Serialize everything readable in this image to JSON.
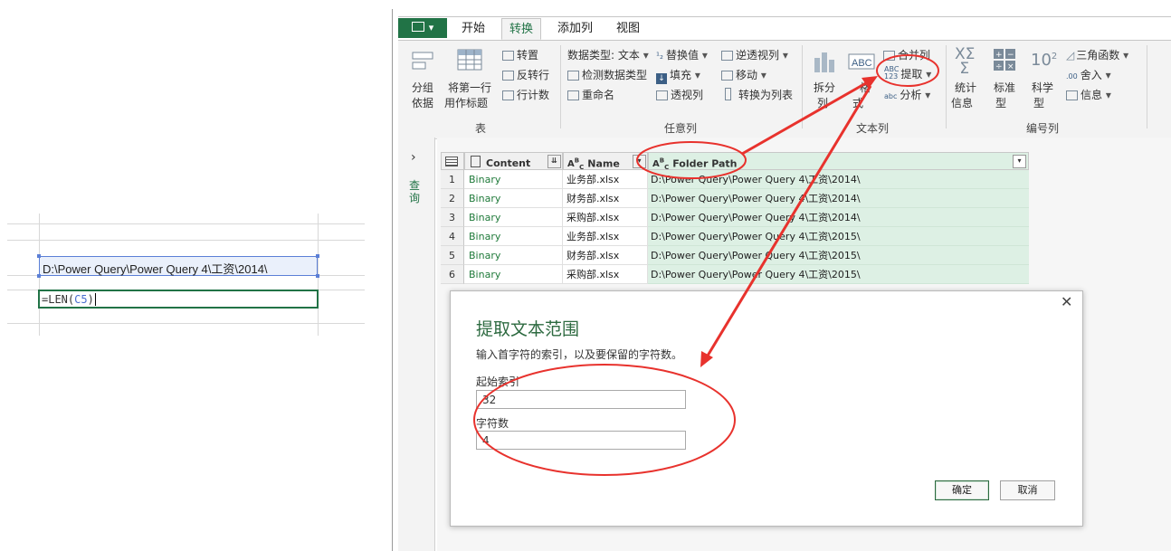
{
  "excel": {
    "cell_c4": "D:\\Power Query\\Power Query 4\\工资\\2014\\",
    "formula_prefix": "=LEN(",
    "formula_ref": "C5",
    "formula_suffix": ")"
  },
  "ribbon": {
    "file_icon": "file-menu-icon",
    "tabs": [
      "开始",
      "转换",
      "添加列",
      "视图"
    ],
    "active_tab": "转换",
    "table_group": {
      "label": "表",
      "group_by": [
        "分组",
        "依据"
      ],
      "use_first_row": [
        "将第一行",
        "用作标题"
      ],
      "transpose": "转置",
      "reverse_rows": "反转行",
      "count_rows": "行计数"
    },
    "any_column_group": {
      "label": "任意列",
      "data_type": "数据类型: 文本",
      "detect_type": "检测数据类型",
      "rename": "重命名",
      "replace_values": "替换值",
      "fill": "填充",
      "pivot": "透视列",
      "unpivot": "逆透视列",
      "move": "移动",
      "to_list": "转换为列表"
    },
    "text_column_group": {
      "label": "文本列",
      "split": [
        "拆分",
        "列"
      ],
      "format": [
        "格",
        "式"
      ],
      "merge": "合并列",
      "extract": "提取",
      "parse": "分析"
    },
    "number_column_group": {
      "label": "编号列",
      "statistics": [
        "统计",
        "信息"
      ],
      "standard": [
        "标准",
        "型"
      ],
      "scientific": [
        "科学",
        "型"
      ],
      "trig": "三角函数",
      "rounding": "舍入",
      "information": "信息"
    },
    "colors": {
      "accent": "#217346",
      "annotation": "#e8322d"
    }
  },
  "nav": {
    "label": "查询",
    "expand_icon": "chevron-right-icon"
  },
  "table": {
    "columns": [
      "Content",
      "Name",
      "Folder Path"
    ],
    "rows": [
      {
        "n": "1",
        "content": "Binary",
        "name": "业务部.xlsx",
        "path": "D:\\Power Query\\Power Query 4\\工资\\2014\\"
      },
      {
        "n": "2",
        "content": "Binary",
        "name": "财务部.xlsx",
        "path": "D:\\Power Query\\Power Query 4\\工资\\2014\\"
      },
      {
        "n": "3",
        "content": "Binary",
        "name": "采购部.xlsx",
        "path": "D:\\Power Query\\Power Query 4\\工资\\2014\\"
      },
      {
        "n": "4",
        "content": "Binary",
        "name": "业务部.xlsx",
        "path": "D:\\Power Query\\Power Query 4\\工资\\2015\\"
      },
      {
        "n": "5",
        "content": "Binary",
        "name": "财务部.xlsx",
        "path": "D:\\Power Query\\Power Query 4\\工资\\2015\\"
      },
      {
        "n": "6",
        "content": "Binary",
        "name": "采购部.xlsx",
        "path": "D:\\Power Query\\Power Query 4\\工资\\2015\\"
      }
    ]
  },
  "dialog": {
    "title": "提取文本范围",
    "description": "输入首字符的索引，以及要保留的字符数。",
    "start_index_label": "起始索引",
    "start_index_value": "32",
    "char_count_label": "字符数",
    "char_count_value": "4",
    "ok": "确定",
    "cancel": "取消",
    "close_icon": "close-icon"
  }
}
